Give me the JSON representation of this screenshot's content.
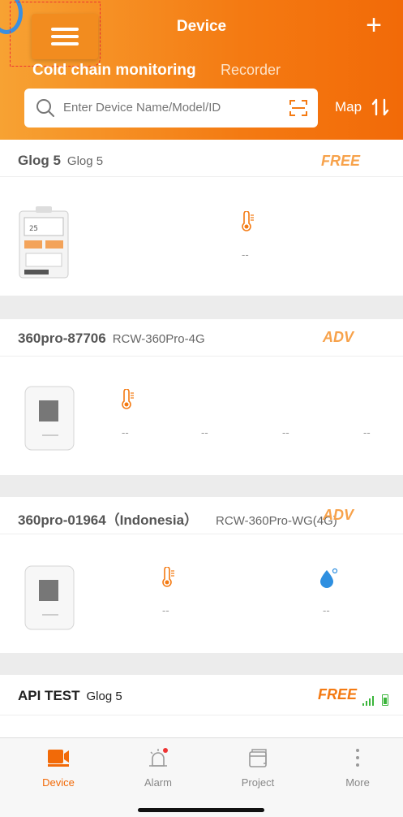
{
  "header": {
    "title": "Device",
    "add_label": "+",
    "tabs": [
      {
        "label": "Cold chain monitoring",
        "active": true
      },
      {
        "label": "Recorder",
        "active": false
      }
    ],
    "search_placeholder": "Enter Device Name/Model/ID",
    "map_label": "Map",
    "accent": "#f47a12"
  },
  "devices": [
    {
      "name": "Glog 5",
      "model": "Glog 5",
      "badge": "FREE",
      "readings": [
        "--"
      ]
    },
    {
      "name": "360pro-87706",
      "model": "RCW-360Pro-4G",
      "badge": "ADV",
      "readings": [
        "--",
        "--",
        "--",
        "--"
      ]
    },
    {
      "name": "360pro-01964（Indonesia）",
      "model": "RCW-360Pro-WG(4G)",
      "badge": "ADV",
      "readings": [
        "--",
        "--"
      ]
    },
    {
      "name": "API TEST",
      "model": "Glog 5",
      "badge": "FREE"
    }
  ],
  "tabbar": {
    "items": [
      {
        "label": "Device",
        "icon": "camera-icon",
        "active": true
      },
      {
        "label": "Alarm",
        "icon": "alarm-icon",
        "active": false
      },
      {
        "label": "Project",
        "icon": "project-icon",
        "active": false
      },
      {
        "label": "More",
        "icon": "more-icon",
        "active": false
      }
    ]
  }
}
